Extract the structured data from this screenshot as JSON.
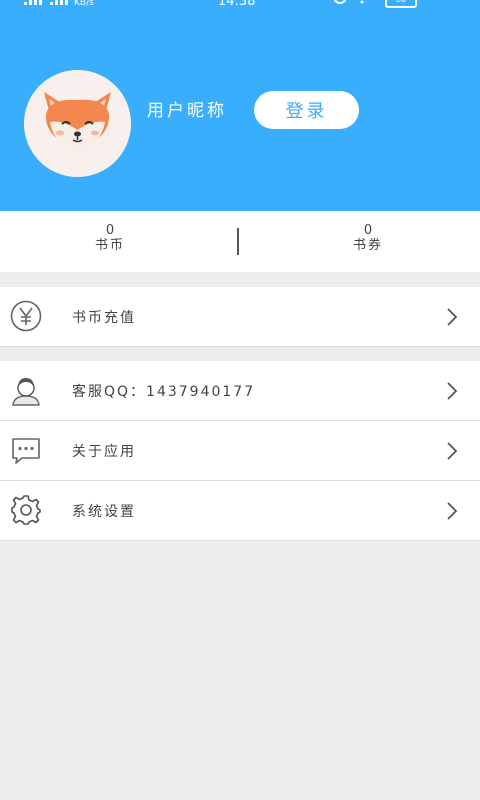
{
  "status_bar": {
    "speed": "KB/s",
    "time": "14:38",
    "battery": "80"
  },
  "profile": {
    "nickname": "用户昵称",
    "login_label": "登录"
  },
  "stats": {
    "coins_value": "0",
    "coins_label": "书币",
    "vouchers_value": "0",
    "vouchers_label": "书券"
  },
  "menu": {
    "recharge": "书币充值",
    "customer_service": "客服QQ：1437940177",
    "about": "关于应用",
    "settings": "系统设置"
  },
  "colors": {
    "header_bg": "#39aefd",
    "page_bg": "#ececec",
    "fox_orange": "#f4874d"
  }
}
